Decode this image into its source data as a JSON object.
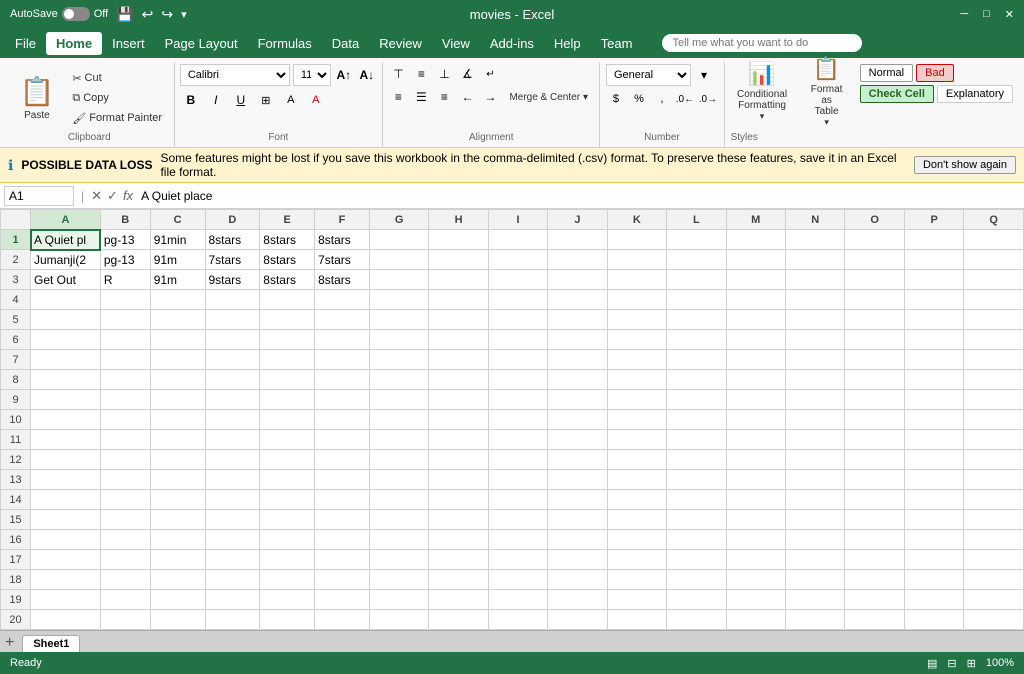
{
  "titleBar": {
    "autosave": "AutoSave",
    "toggleState": "Off",
    "title": "movies - Excel",
    "quickAccessIcons": [
      "save",
      "undo",
      "redo",
      "dropdown"
    ]
  },
  "menuBar": {
    "items": [
      "File",
      "Home",
      "Insert",
      "Page Layout",
      "Formulas",
      "Data",
      "Review",
      "View",
      "Add-ins",
      "Help",
      "Team"
    ],
    "activeItem": "Home",
    "searchPlaceholder": "Tell me what you want to do"
  },
  "ribbon": {
    "groups": [
      {
        "name": "Clipboard",
        "label": "Clipboard",
        "pasteLabel": "Paste",
        "cutLabel": "Cut",
        "copyLabel": "Copy",
        "formatPainterLabel": "Format Painter"
      },
      {
        "name": "Font",
        "label": "Font",
        "fontName": "Calibri",
        "fontSize": "11",
        "boldLabel": "B",
        "italicLabel": "I",
        "underlineLabel": "U"
      },
      {
        "name": "Alignment",
        "label": "Alignment",
        "wrapTextLabel": "Wrap Text",
        "mergeLabel": "Merge & Center"
      },
      {
        "name": "Number",
        "label": "Number",
        "format": "General"
      },
      {
        "name": "Styles",
        "label": "Styles",
        "conditionalLabel": "Conditional\nFormatting",
        "formatAsTableLabel": "Format as\nTable",
        "normalLabel": "Normal",
        "badLabel": "Bad",
        "checkCellLabel": "Check Cell",
        "explanatoryLabel": "Explanatory"
      }
    ]
  },
  "infoBar": {
    "icon": "ℹ",
    "boldText": "POSSIBLE DATA LOSS",
    "message": "Some features might be lost if you save this workbook in the comma-delimited (.csv) format. To preserve these features, save it in an Excel file format.",
    "dismissLabel": "Don't show again"
  },
  "formulaBar": {
    "cellRef": "A1",
    "formula": "A Quiet place"
  },
  "spreadsheet": {
    "columns": [
      "A",
      "B",
      "C",
      "D",
      "E",
      "F",
      "G",
      "H",
      "I",
      "J",
      "K",
      "L",
      "M",
      "N",
      "O",
      "P",
      "Q"
    ],
    "rows": 20,
    "selectedCell": "A1",
    "data": {
      "A1": "A Quiet pl",
      "B1": "pg-13",
      "C1": "91min",
      "D1": "8stars",
      "E1": "8stars",
      "F1": "8stars",
      "A2": "Jumanji(2",
      "B2": "pg-13",
      "C2": "91m",
      "D2": "7stars",
      "E2": "8stars",
      "F2": "7stars",
      "A3": "Get Out",
      "B3": "R",
      "C3": "91m",
      "D3": "9stars",
      "E3": "8stars",
      "F3": "8stars"
    }
  },
  "sheetTabs": {
    "tabs": [
      "Sheet1"
    ],
    "activeTab": "Sheet1"
  },
  "statusBar": {
    "leftText": "Ready",
    "zoomLabel": "100%"
  }
}
